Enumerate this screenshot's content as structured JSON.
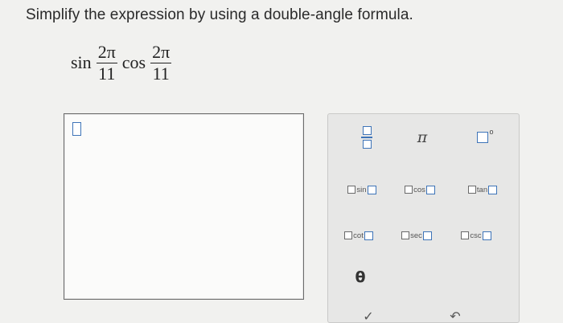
{
  "prompt": "Simplify the expression by using a double-angle formula.",
  "expression": {
    "fn1": "sin",
    "frac1": {
      "num": "2π",
      "den": "11"
    },
    "fn2": "cos",
    "frac2": {
      "num": "2π",
      "den": "11"
    }
  },
  "palette": {
    "pi": "π",
    "degree": "o",
    "sin": "sin",
    "cos": "cos",
    "tan": "tan",
    "cot": "cot",
    "sec": "sec",
    "csc": "csc",
    "theta": "θ",
    "partial_left": "✓",
    "partial_right": "↶"
  },
  "colors": {
    "accent": "#3e74b8",
    "background": "#f1f1ef"
  }
}
